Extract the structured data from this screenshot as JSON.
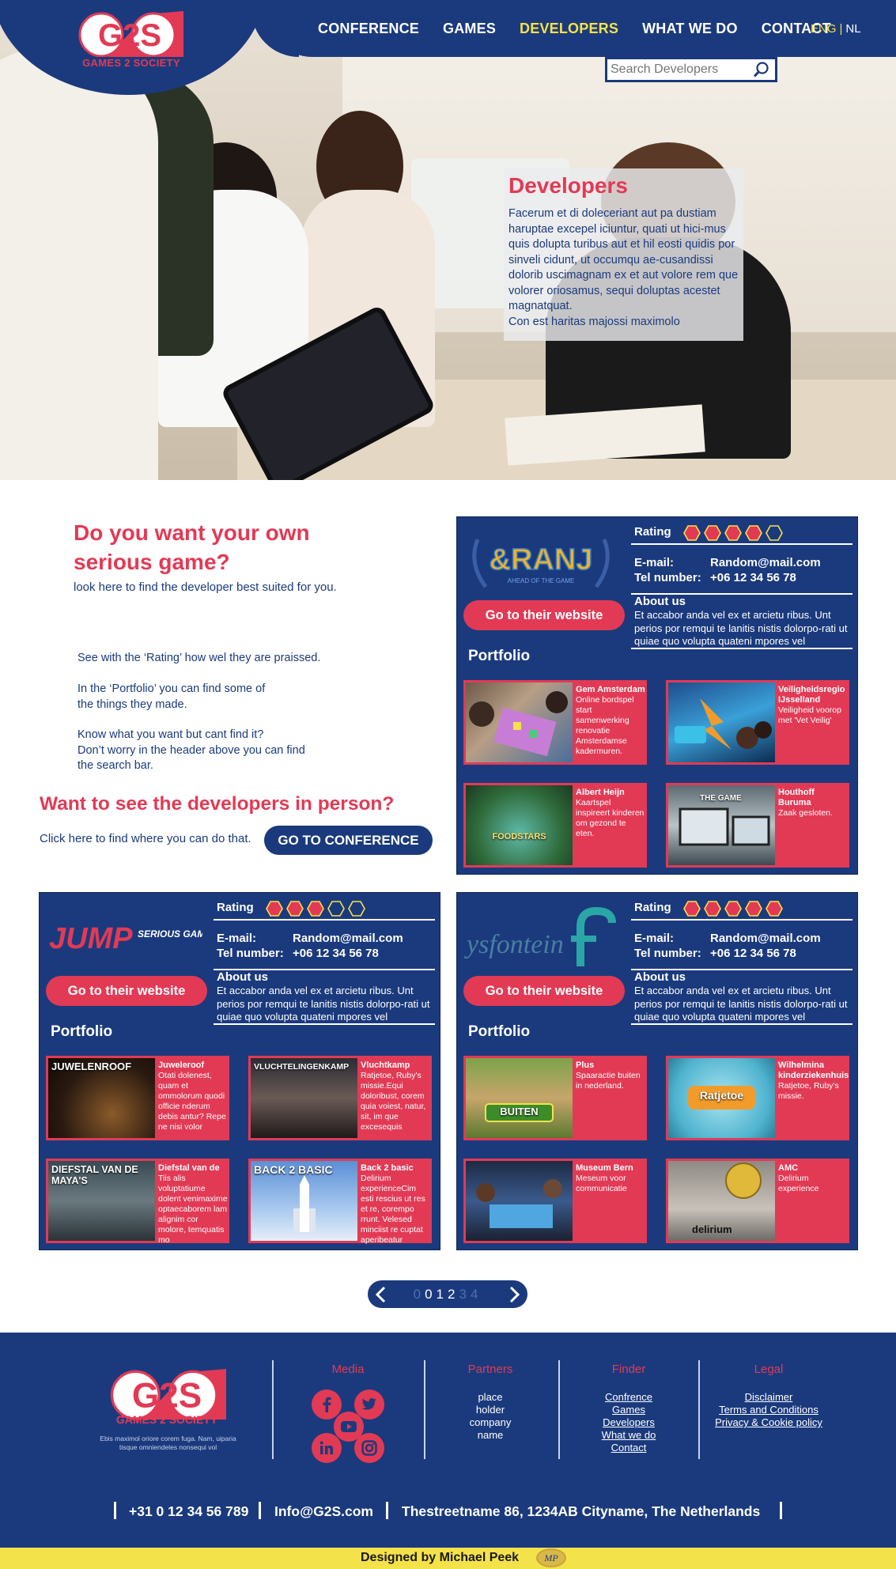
{
  "brand": {
    "logo_letters": "G2S",
    "logo_caption": "GAMES 2 SOCIETY",
    "accent": "#e23a55",
    "primary": "#1b3a7d",
    "highlight": "#f4e24a"
  },
  "nav": {
    "items": [
      {
        "label": "CONFERENCE",
        "active": false
      },
      {
        "label": "GAMES",
        "active": false
      },
      {
        "label": "DEVELOPERS",
        "active": true
      },
      {
        "label": "WHAT WE DO",
        "active": false
      },
      {
        "label": "CONTACT",
        "active": false
      }
    ],
    "lang_active": "ENG",
    "lang_sep": "|",
    "lang_other": "NL"
  },
  "search": {
    "placeholder": "Search Developers",
    "icon": "search-icon"
  },
  "hero": {
    "title": "Developers",
    "text": "Facerum et di doleceriant aut pa dustiam haruptae excepel iciuntur, quati ut hici-mus quis dolupta turibus aut et hil eosti quidis por sinveli cidunt, ut occumqu ae-cusandissi dolorib uscimagnam ex et aut volore rem que volorer oriosamus, sequi doluptas acestet magnatquat.",
    "text2": "Con est haritas majossi maximolo"
  },
  "intro": {
    "title": "Do you want your own serious game?",
    "subtitle": "look here to find the developer best suited for you.",
    "p1": "See with the ‘Rating’ how wel they are praissed.",
    "p2a": "In the ‘Portfolio’ you can find some of",
    "p2b": "the things they made.",
    "p3a": "Know what you want but cant find it?",
    "p3b": "Don’t worry in the header above you can find",
    "p3c": "the search bar.",
    "inperson_title": "Want to see the developers in person?",
    "inperson_text": "Click here to find where you can do that.",
    "conf_button": "GO TO CONFERENCE"
  },
  "labels": {
    "rating": "Rating",
    "email": "E-mail:",
    "tel": "Tel number:",
    "about": "About us",
    "website_button": "Go to their website",
    "portfolio": "Portfolio"
  },
  "developers": [
    {
      "name": "&RANJ",
      "tagline": "AHEAD OF THE GAME",
      "rating": 4,
      "rating_max": 5,
      "email": "Random@mail.com",
      "tel": "+06 12 34 56 78",
      "about": "Et accabor anda vel ex et arcietu ribus. Unt perios por remqui te lanitis nistis dolorpo-rati ut quiae quo volupta quateni mpores vel",
      "portfolio": [
        {
          "title": "Gem Amsterdam",
          "desc": "Online bordspel start samenwerking renovatie Amsterdamse kadermuren.",
          "thumb_label": ""
        },
        {
          "title": "Veiligheidsregio IJsselland",
          "desc": "Veiligheid voorop met 'Vet Veilig'",
          "thumb_label": ""
        },
        {
          "title": "Albert Heijn",
          "desc": "Kaartspel inspireert kinderen om gezond te eten.",
          "thumb_label": "FOODSTARS"
        },
        {
          "title": "Houthoff Buruma",
          "desc": "Zaak gesloten.",
          "thumb_label": "THE GAME"
        }
      ]
    },
    {
      "name": "JUMP",
      "name2": "SERIOUS GAMES",
      "rating": 3,
      "rating_max": 5,
      "email": "Random@mail.com",
      "tel": "+06 12 34 56 78",
      "about": "Et accabor anda vel ex et arcietu ribus. Unt perios por remqui te lanitis nistis dolorpo-rati ut quiae quo volupta quateni mpores vel",
      "portfolio": [
        {
          "title": "Juweleroof",
          "desc": "Otati dolenest, quam et ommolorum quodi officie nderum debis antur? Repe ne nisi volor",
          "thumb_label": "JUWELENROOF"
        },
        {
          "title": "Vluchtkamp",
          "desc": "Ratjetoe, Ruby's missie.Equi doloribust, corem quia voiest, natur, sit, im que excesequis",
          "thumb_label": "VLUCHTELINGENKAMP"
        },
        {
          "title": "Diefstal van de",
          "desc": "Tiis alis voluptatiume dolent venimaxime optaecaborem lam alignim cor molore, temquatis mo",
          "thumb_label": "DIEFSTAL VAN DE MAYA'S"
        },
        {
          "title": "Back 2 basic",
          "desc": "Delirium experienceCim esti rescius ut res et re, corempo rrunt. Velesed minciist re cuptat aperibeatur",
          "thumb_label": "BACK 2 BASIC"
        }
      ]
    },
    {
      "name": "ysfontein",
      "rating": 5,
      "rating_max": 5,
      "email": "Random@mail.com",
      "tel": "+06 12 34 56 78",
      "about": "Et accabor anda vel ex et arcietu ribus. Unt perios por remqui te lanitis nistis dolorpo-rati ut quiae quo volupta quateni mpores vel",
      "portfolio": [
        {
          "title": "Plus",
          "desc": "Spaaractie buiten in nederland.",
          "thumb_label": "BUITEN"
        },
        {
          "title": "Wilhelmina kinderziekenhuis",
          "desc": "Ratjetoe, Ruby's missie.",
          "thumb_label": "Ratjetoe"
        },
        {
          "title": "Museum Bern",
          "desc": "Meseum voor communicatie",
          "thumb_label": ""
        },
        {
          "title": "AMC",
          "desc": "Delirium experience",
          "thumb_label": "delirium"
        }
      ]
    }
  ],
  "pager": {
    "numbers": [
      "0",
      "0",
      "1",
      "2",
      "3",
      "4"
    ],
    "current_index": 2
  },
  "footer": {
    "tagline": "Ebis maximol oriore corem fuga. Nam, uiparia tisque omniendeles nonsequi vol",
    "media_h": "Media",
    "partners_h": "Partners",
    "partners": [
      "place",
      "holder",
      "company",
      "name"
    ],
    "finder_h": "Finder",
    "finder": [
      "Confrence",
      "Games",
      "Developers",
      "What we do",
      "Contact"
    ],
    "legal_h": "Legal",
    "legal": [
      "Disclaimer",
      "Terms and Conditions",
      "Privacy & Cookie policy"
    ],
    "social_icons": [
      "facebook-icon",
      "twitter-icon",
      "youtube-icon",
      "linkedin-icon",
      "instagram-icon"
    ],
    "phone": "+31 0 12 34 56 789",
    "email": "Info@G2S.com",
    "address": "Thestreetname 86, 1234AB Cityname, The Netherlands",
    "designed_by": "Designed by Michael Peek",
    "designer_mark": "MP"
  }
}
